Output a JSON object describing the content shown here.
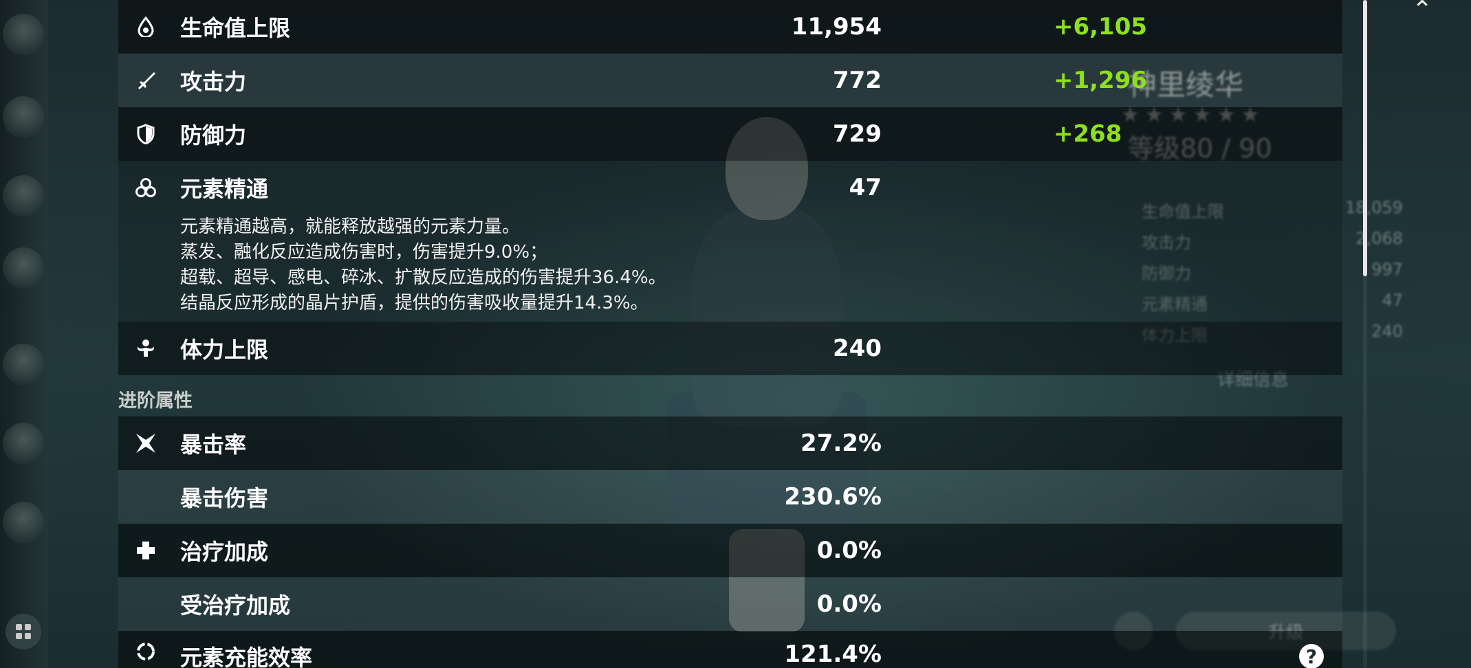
{
  "background": {
    "character_name": "神里绫华",
    "level_text": "等级80 / 90",
    "stars": "★★★★★★",
    "summary_rows": [
      {
        "label": "生命值上限",
        "value": "18,059"
      },
      {
        "label": "攻击力",
        "value": "2,068"
      },
      {
        "label": "防御力",
        "value": "997"
      },
      {
        "label": "元素精通",
        "value": "47"
      },
      {
        "label": "体力上限",
        "value": "240"
      }
    ],
    "detail_button": "详细信息",
    "upgrade_button": "升级"
  },
  "section_advanced_title": "进阶属性",
  "stats": {
    "hp": {
      "label": "生命值上限",
      "value": "11,954",
      "bonus": "+6,105",
      "icon": "hp-drop-icon"
    },
    "atk": {
      "label": "攻击力",
      "value": "772",
      "bonus": "+1,296",
      "icon": "sword-icon"
    },
    "def": {
      "label": "防御力",
      "value": "729",
      "bonus": "+268",
      "icon": "shield-icon"
    },
    "em": {
      "label": "元素精通",
      "value": "47",
      "icon": "elemental-mastery-icon",
      "desc": [
        "元素精通越高，就能释放越强的元素力量。",
        "蒸发、融化反应造成伤害时，伤害提升9.0%；",
        "超载、超导、感电、碎冰、扩散反应造成的伤害提升36.4%。",
        "结晶反应形成的晶片护盾，提供的伤害吸收量提升14.3%。"
      ]
    },
    "stamina": {
      "label": "体力上限",
      "value": "240",
      "icon": "stamina-icon"
    },
    "crit_rate": {
      "label": "暴击率",
      "value": "27.2%",
      "icon": "crit-star-icon"
    },
    "crit_dmg": {
      "label": "暴击伤害",
      "value": "230.6%"
    },
    "healing": {
      "label": "治疗加成",
      "value": "0.0%",
      "icon": "healing-cross-icon"
    },
    "incoming_healing": {
      "label": "受治疗加成",
      "value": "0.0%"
    },
    "energy_recharge": {
      "label": "元素充能效率",
      "value": "121.4%",
      "icon": "energy-recharge-icon"
    }
  },
  "colors": {
    "bonus_green": "#8ee01f",
    "row_shade": "rgba(0,0,0,0.48)"
  }
}
